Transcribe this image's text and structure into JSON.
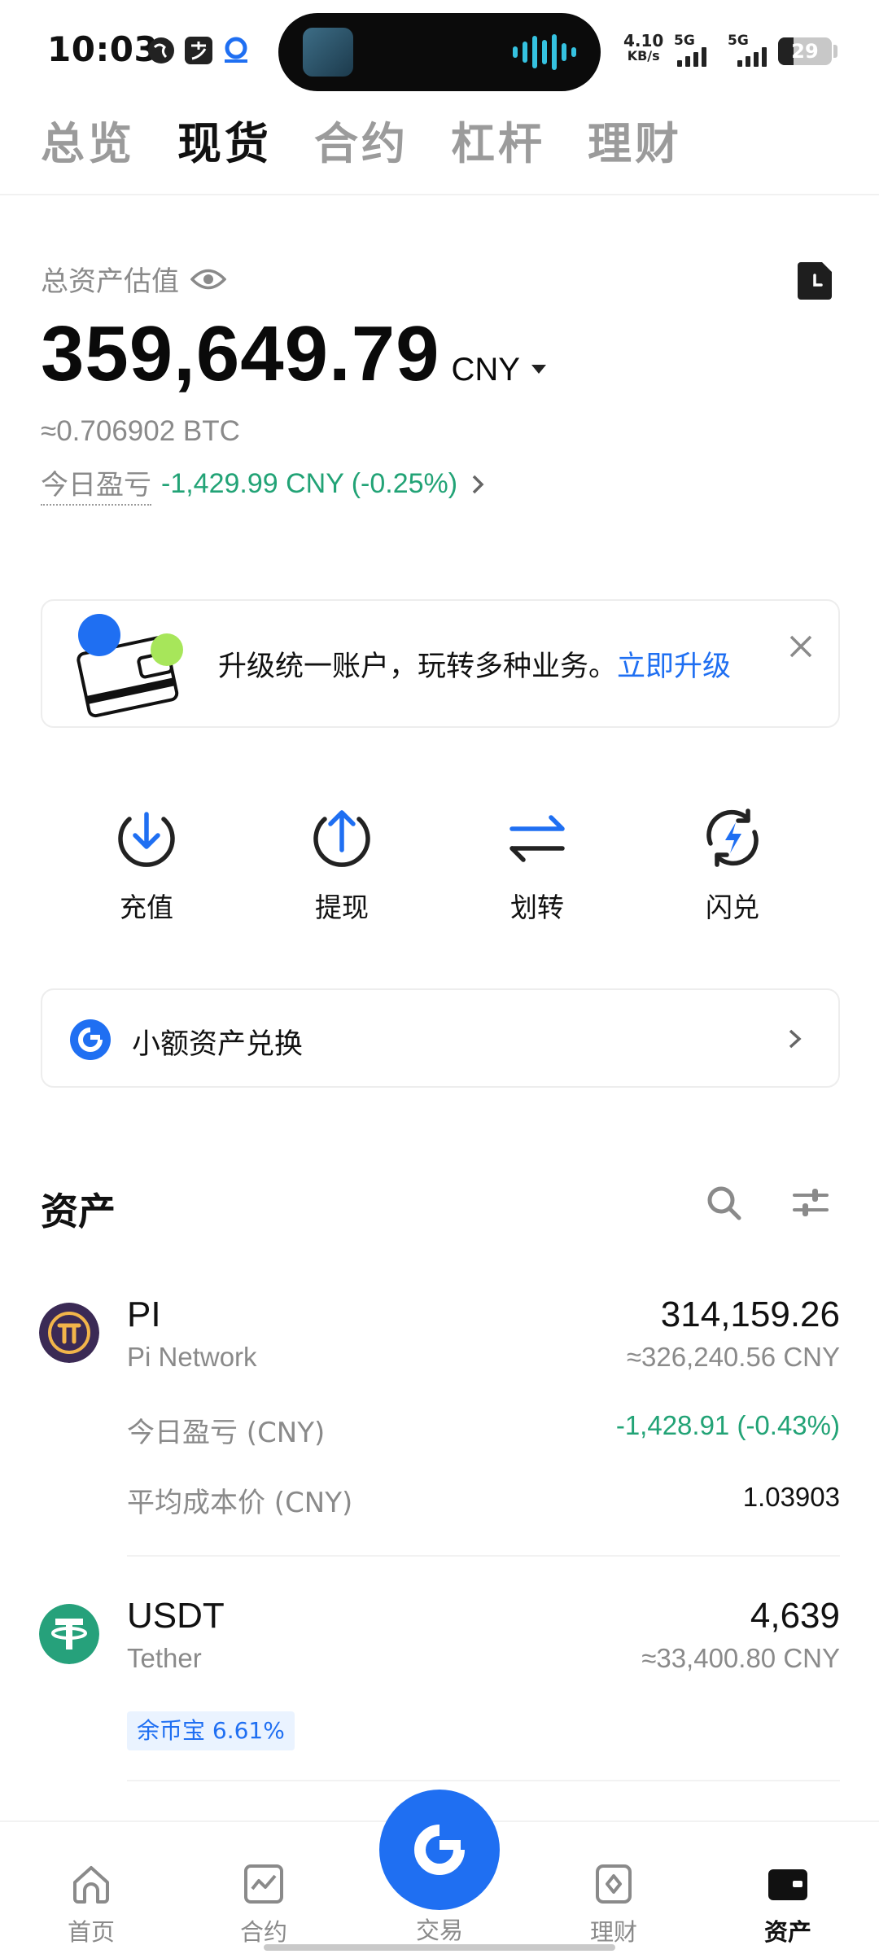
{
  "status_bar": {
    "time": "10:03",
    "speed_value": "4.10",
    "speed_unit": "KB/s",
    "network_1": "5G",
    "network_2": "5G",
    "battery": "29",
    "battery_level": 0.29
  },
  "top_tabs": [
    {
      "label": "总览",
      "active": false
    },
    {
      "label": "现货",
      "active": true
    },
    {
      "label": "合约",
      "active": false
    },
    {
      "label": "杠杆",
      "active": false
    },
    {
      "label": "理财",
      "active": false
    }
  ],
  "balance": {
    "label": "总资产估值",
    "value": "359,649.79",
    "currency": "CNY",
    "btc_value": "≈0.706902 BTC",
    "pnl_label": "今日盈亏",
    "pnl_value": "-1,429.99 CNY (-0.25%)"
  },
  "banner": {
    "text": "升级统一账户，玩转多种业务。",
    "link": "立即升级"
  },
  "actions": [
    {
      "label": "充值",
      "icon": "deposit-icon"
    },
    {
      "label": "提现",
      "icon": "withdraw-icon"
    },
    {
      "label": "划转",
      "icon": "transfer-icon"
    },
    {
      "label": "闪兑",
      "icon": "flash-convert-icon"
    }
  ],
  "small_convert": {
    "label": "小额资产兑换"
  },
  "assets": {
    "title": "资产",
    "items": [
      {
        "symbol": "PI",
        "name": "Pi Network",
        "amount": "314,159.26",
        "cny": "≈326,240.56 CNY",
        "pnl_label": "今日盈亏 (CNY)",
        "pnl_value": "-1,428.91 (-0.43%)",
        "cost_label": "平均成本价 (CNY)",
        "cost_value": "1.03903"
      },
      {
        "symbol": "USDT",
        "name": "Tether",
        "amount": "4,639",
        "cny": "≈33,400.80 CNY",
        "badge": "余币宝 6.61%"
      }
    ]
  },
  "bottom_nav": [
    {
      "label": "首页",
      "icon": "home-icon"
    },
    {
      "label": "合约",
      "icon": "futures-icon"
    },
    {
      "label": "交易",
      "icon": "trade-icon"
    },
    {
      "label": "理财",
      "icon": "earn-icon"
    },
    {
      "label": "资产",
      "icon": "wallet-icon",
      "active": true
    }
  ],
  "colors": {
    "accent": "#1f6ff2",
    "positive_green": "#22a376",
    "muted_text": "#8a8a8a",
    "pi_purple": "#3b2a55",
    "pi_gold": "#f2b54a",
    "usdt_green": "#26a17b"
  }
}
